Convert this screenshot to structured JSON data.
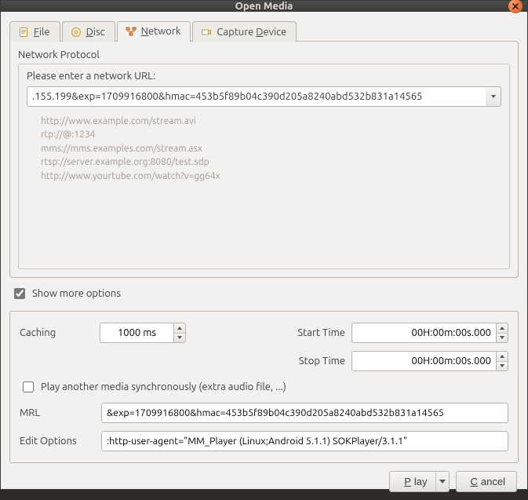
{
  "window": {
    "title": "Open Media"
  },
  "tabs": {
    "file": {
      "pre": "",
      "mn": "F",
      "post": "ile"
    },
    "disc": {
      "pre": "",
      "mn": "D",
      "post": "isc"
    },
    "network": {
      "pre": "",
      "mn": "N",
      "post": "etwork"
    },
    "capture": {
      "pre": "Capture ",
      "mn": "D",
      "post": "evice"
    }
  },
  "network": {
    "group_label": "Network Protocol",
    "prompt": "Please enter a network URL:",
    "url_value": ".155.199&exp=1709916800&hmac=453b5f89b04c390d205a8240abd532b831a14565",
    "examples": [
      "http://www.example.com/stream.avi",
      "rtp://@:1234",
      "mms://mms.examples.com/stream.asx",
      "rtsp://server.example.org:8080/test.sdp",
      "http://www.yourtube.com/watch?v=gg64x"
    ]
  },
  "more": {
    "label_pre": "Show ",
    "label_mn": "m",
    "label_post": "ore options",
    "checked": true
  },
  "options": {
    "caching_label": "Caching",
    "caching_value": "1000 ms",
    "start_label": "Start Time",
    "start_value": "00H:00m:00s.000",
    "stop_label": "Stop Time",
    "stop_value": "00H:00m:00s.000",
    "sync_label": "Play another media synchronously (extra audio file, ...)",
    "sync_checked": false,
    "mrl_label": "MRL",
    "mrl_value": "&exp=1709916800&hmac=453b5f89b04c390d205a8240abd532b831a14565",
    "edit_label": "Edit Options",
    "edit_value": ":http-user-agent=\"MM_Player (Linux;Android 5.1.1) SOKPlayer/3.1.1\""
  },
  "footer": {
    "play_pre": "",
    "play_mn": "P",
    "play_post": "lay",
    "cancel_pre": "",
    "cancel_mn": "C",
    "cancel_post": "ancel"
  }
}
